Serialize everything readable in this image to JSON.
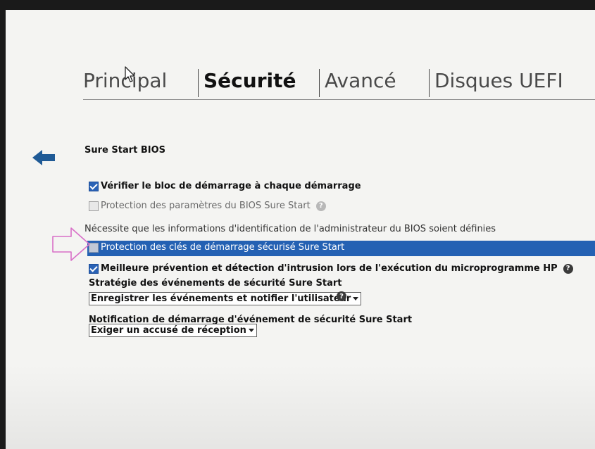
{
  "tabs": [
    {
      "label": "Principal",
      "active": false
    },
    {
      "label": "Sécurité",
      "active": true
    },
    {
      "label": "Avancé",
      "active": false
    },
    {
      "label": "Disques UEFI",
      "active": false
    }
  ],
  "section": {
    "title": "Sure Start BIOS"
  },
  "options": {
    "verify_boot_block": {
      "label": "Vérifier le bloc de démarrage à chaque démarrage",
      "checked": true
    },
    "bios_settings_protection": {
      "label": "Protection des paramètres du BIOS Sure Start",
      "checked": false,
      "enabled": false
    },
    "requires_admin_note": "Nécessite que les informations d'identification de l'administrateur du BIOS soient définies",
    "secure_boot_keys_protection": {
      "label": "Protection des clés de démarrage sécurisé Sure Start",
      "checked": false,
      "selected": true
    },
    "intrusion_prevention": {
      "label": "Meilleure prévention et détection d'intrusion lors de l'exécution du microprogramme HP",
      "checked": true
    }
  },
  "event_policy": {
    "label": "Stratégie des événements de sécurité Sure Start",
    "value": "Enregistrer les événements et notifier l'utilisateur"
  },
  "event_notification": {
    "label": "Notification de démarrage d'événement de sécurité Sure Start",
    "value": "Exiger un accusé de réception"
  },
  "icons": {
    "help": "?",
    "back": "left-arrow-icon",
    "cursor": "mouse-pointer-icon"
  },
  "colors": {
    "highlight": "#2461b3",
    "checkbox_checked": "#2a62b5",
    "annotation": "#d86fc8"
  }
}
